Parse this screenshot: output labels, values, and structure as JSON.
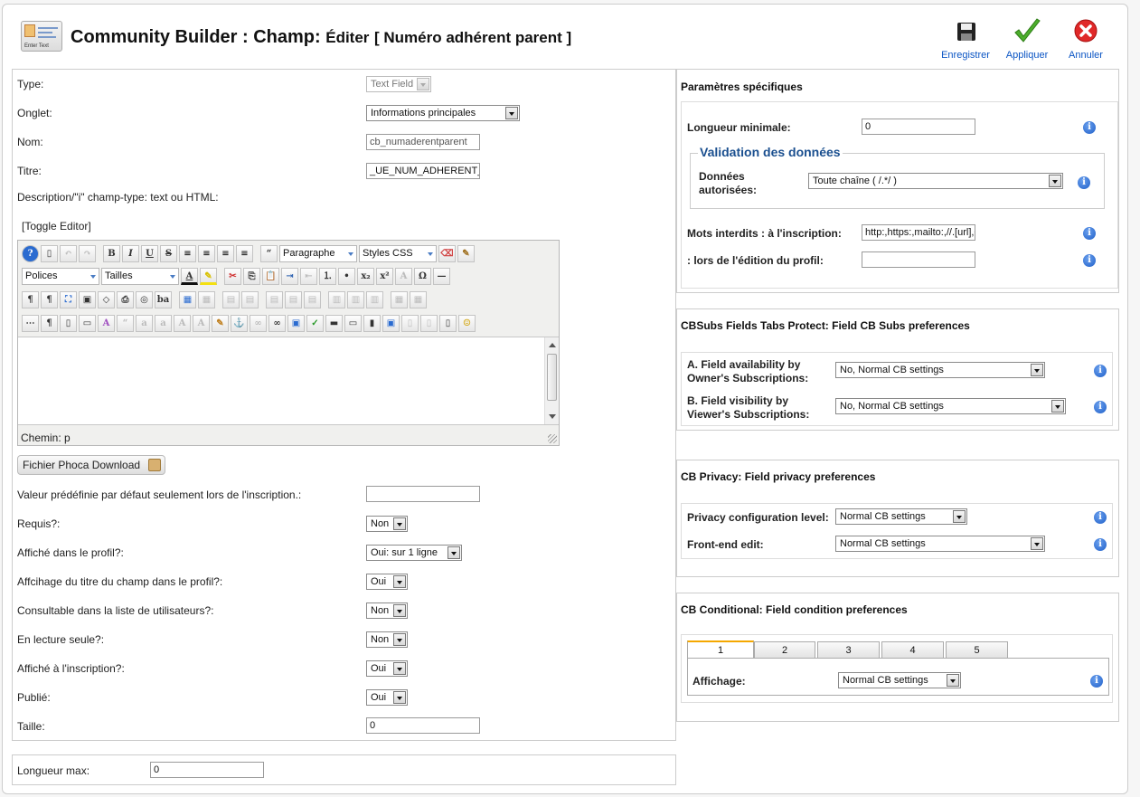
{
  "header": {
    "title_main": "Community Builder : Champ:",
    "title_sub": "Éditer",
    "title_bracket": "[ Numéro adhérent parent ]",
    "icon_caption": "Enter Text"
  },
  "toolbar": {
    "save": "Enregistrer",
    "apply": "Appliquer",
    "cancel": "Annuler"
  },
  "form": {
    "type_label": "Type:",
    "type_value": "Text Field",
    "tab_label": "Onglet:",
    "tab_value": "Informations principales",
    "name_label": "Nom:",
    "name_value": "cb_numaderentparent",
    "title_label": "Titre:",
    "title_value": "_UE_NUM_ADHERENT_PA",
    "description_label": "Description/\"i\" champ-type: text ou HTML:",
    "toggle_editor": "[Toggle Editor]",
    "editor": {
      "format_select": "Paragraphe",
      "styles_select": "Styles CSS",
      "fonts_select": "Polices",
      "sizes_select": "Tailles",
      "path_label": "Chemin: p"
    },
    "phoca_button": "Fichier Phoca Download",
    "default_label": "Valeur prédéfinie par défaut seulement lors de l'inscription.:",
    "default_value": "",
    "required_label": "Requis?:",
    "required_value": "Non",
    "profile_label": "Affiché dans le profil?:",
    "profile_value": "Oui: sur 1 ligne",
    "title_profile_label": "Affcihage du titre du champ dans le profil?:",
    "title_profile_value": "Oui",
    "searchable_label": "Consultable dans la liste de utilisateurs?:",
    "searchable_value": "Non",
    "readonly_label": "En lecture seule?:",
    "readonly_value": "Non",
    "registration_label": "Affiché à l'inscription?:",
    "registration_value": "Oui",
    "published_label": "Publié:",
    "published_value": "Oui",
    "size_label": "Taille:",
    "size_value": "0",
    "maxlength_label": "Longueur max:",
    "maxlength_value": "0"
  },
  "specific": {
    "title": "Paramètres spécifiques",
    "minlength_label": "Longueur minimale:",
    "minlength_value": "0",
    "validation_legend": "Validation des données",
    "allowed_label_1": "Données",
    "allowed_label_2": "autorisées:",
    "allowed_value": "Toute chaîne ( /.*/ )",
    "forbidden_reg_label": "Mots interdits : à l'inscription:",
    "forbidden_reg_value": "http:,https:,mailto:,//.[url],<",
    "forbidden_edit_label": ": lors de l'édition du profil:",
    "forbidden_edit_value": ""
  },
  "cbsubs": {
    "title": "CBSubs Fields Tabs Protect: Field CB Subs preferences",
    "a_label_1": "A. Field availability by",
    "a_label_2": "Owner's Subscriptions:",
    "a_value": "No, Normal CB settings",
    "b_label_1": "B. Field visibility by",
    "b_label_2": "Viewer's Subscriptions:",
    "b_value": "No, Normal CB settings"
  },
  "privacy": {
    "title": "CB Privacy: Field privacy preferences",
    "level_label": "Privacy configuration level:",
    "level_value": "Normal CB settings",
    "frontend_label": "Front-end edit:",
    "frontend_value": "Normal CB settings"
  },
  "conditional": {
    "title": "CB Conditional: Field condition preferences",
    "tabs": [
      "1",
      "2",
      "3",
      "4",
      "5"
    ],
    "display_label": "Affichage:",
    "display_value": "Normal CB settings"
  },
  "icons": {
    "save": "floppy-disk-icon",
    "apply": "check-icon",
    "cancel": "cancel-icon",
    "info": "info-icon"
  },
  "colors": {
    "toolbar_text": "#0b55c4",
    "legend": "#1a4f8f",
    "info_blue": "#1f5fc8",
    "active_tab": "#f5a800"
  }
}
